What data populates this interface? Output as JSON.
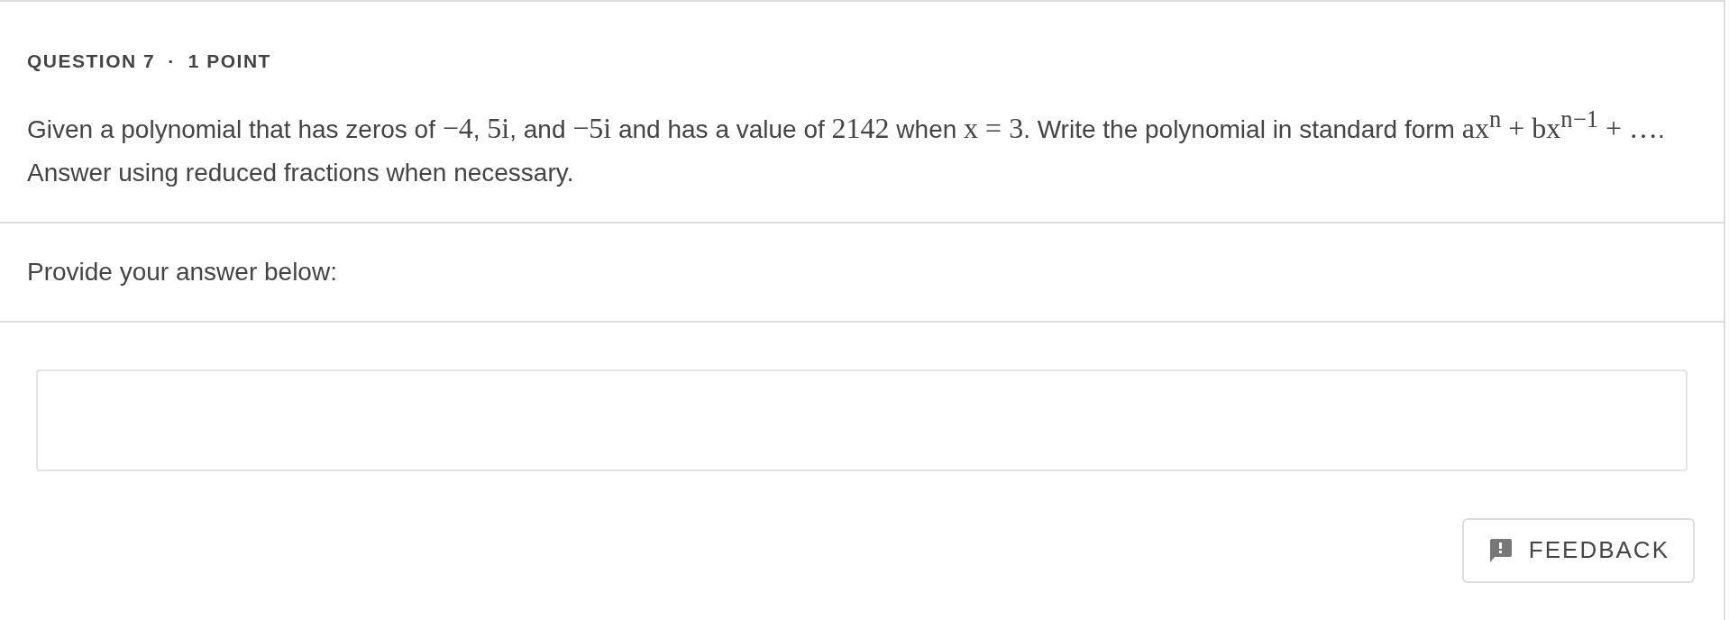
{
  "question": {
    "number": "QUESTION 7",
    "separator": "·",
    "points": "1 POINT",
    "text": [
      {
        "kind": "text",
        "text": "Given a polynomial that has zeros of "
      },
      {
        "kind": "math",
        "text": "−4"
      },
      {
        "kind": "text",
        "text": ", "
      },
      {
        "kind": "math",
        "text": "5i"
      },
      {
        "kind": "text",
        "text": ", and "
      },
      {
        "kind": "math",
        "text": "−5i"
      },
      {
        "kind": "text",
        "text": " and has a value of "
      },
      {
        "kind": "math",
        "text": "2142"
      },
      {
        "kind": "text",
        "text": " when "
      },
      {
        "kind": "math",
        "text": "x = 3"
      },
      {
        "kind": "text",
        "text": ". Write the polynomial in standard form "
      },
      {
        "kind": "math",
        "text": "ax$^{n}$ + bx$^{n−1}$  + …"
      },
      {
        "kind": "text",
        "text": ". Answer using reduced fractions when necessary."
      }
    ]
  },
  "answer": {
    "prompt": "Provide your answer below:"
  },
  "feedback_button": {
    "label": "FEEDBACK"
  }
}
